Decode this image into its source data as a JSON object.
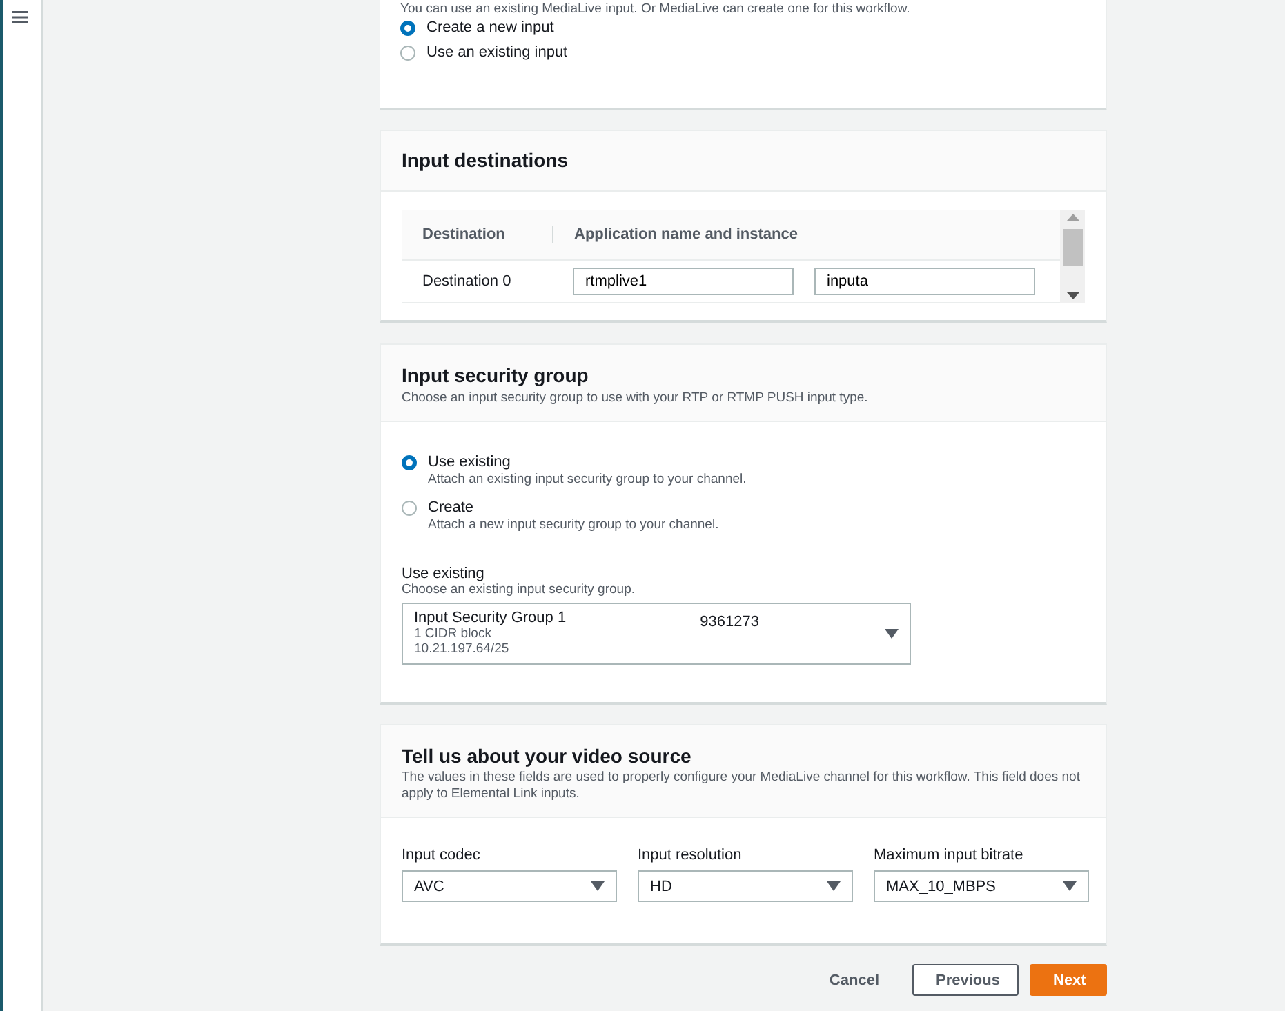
{
  "input_choice": {
    "description": "You can use an existing MediaLive input. Or MediaLive can create one for this workflow.",
    "options": [
      {
        "label": "Create a new input",
        "selected": true
      },
      {
        "label": "Use an existing input",
        "selected": false
      }
    ]
  },
  "input_destinations": {
    "title": "Input destinations",
    "columns": [
      "Destination",
      "Application name and instance"
    ],
    "rows": [
      {
        "destination": "Destination 0",
        "application_name": "rtmplive1",
        "instance": "inputa"
      }
    ]
  },
  "input_security_group": {
    "title": "Input security group",
    "description": "Choose an input security group to use with your RTP or RTMP PUSH input type.",
    "options": [
      {
        "label": "Use existing",
        "description": "Attach an existing input security group to your channel.",
        "selected": true
      },
      {
        "label": "Create",
        "description": "Attach a new input security group to your channel.",
        "selected": false
      }
    ],
    "select": {
      "label": "Use existing",
      "description": "Choose an existing input security group.",
      "name": "Input Security Group 1",
      "id": "9361273",
      "detail": "1 CIDR block",
      "cidr": "10.21.197.64/25"
    }
  },
  "video_source": {
    "title": "Tell us about your video source",
    "description": "The values in these fields are used to properly configure your MediaLive channel for this workflow. This field does not apply to Elemental Link inputs.",
    "fields": [
      {
        "label": "Input codec",
        "value": "AVC"
      },
      {
        "label": "Input resolution",
        "value": "HD"
      },
      {
        "label": "Maximum input bitrate",
        "value": "MAX_10_MBPS"
      }
    ]
  },
  "buttons": [
    {
      "label": "Cancel",
      "kind": "link"
    },
    {
      "label": "Previous",
      "kind": "secondary"
    },
    {
      "label": "Next",
      "kind": "primary"
    }
  ]
}
